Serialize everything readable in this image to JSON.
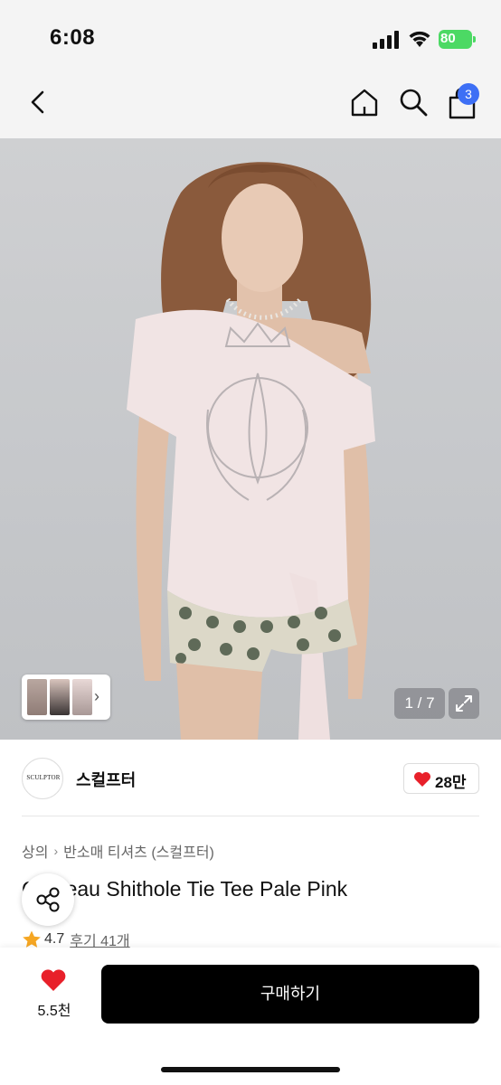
{
  "status_bar": {
    "time": "6:08",
    "battery": "80"
  },
  "header": {
    "cart_count": "3"
  },
  "gallery": {
    "page_indicator": "1 / 7",
    "thumb_chevron": "›"
  },
  "brand": {
    "logo_text": "SCULPTOR",
    "name": "스컬프터",
    "likes": "28만"
  },
  "breadcrumb": {
    "category": "상의",
    "separator": "›",
    "subcategory": "반소매 티셔츠 (스컬프터)"
  },
  "product": {
    "title": "Chateau Shithole Tie Tee Pale Pink",
    "rating": "4.7",
    "reviews": "후기 41개"
  },
  "bottom_bar": {
    "wish_count": "5.5천",
    "buy_label": "구매하기"
  },
  "colors": {
    "accent_blue": "#3d6ff5",
    "heart_red": "#e8202a",
    "star_orange": "#f5a623",
    "battery_green": "#4cd964"
  }
}
